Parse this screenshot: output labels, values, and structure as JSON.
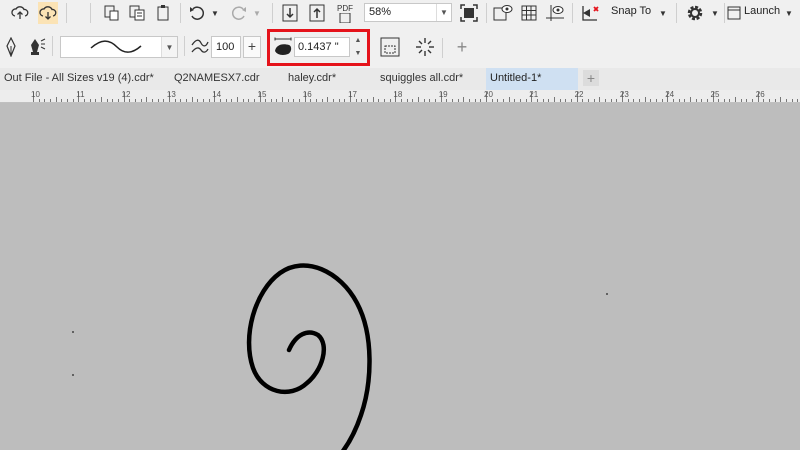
{
  "toolbar": {
    "zoom_value": "58%",
    "snap_label": "Snap To",
    "launch_label": "Launch",
    "pdf_label": "PDF"
  },
  "property_bar": {
    "smoothing_value": "100",
    "outline_width_value": "0.1437 \""
  },
  "tabs": [
    {
      "label": "Out File - All Sizes v19 (4).cdr*",
      "active": false
    },
    {
      "label": "Q2NAMESX7.cdr",
      "active": false
    },
    {
      "label": "haley.cdr*",
      "active": false
    },
    {
      "label": "squiggles all.cdr*",
      "active": false
    },
    {
      "label": "Untitled-1*",
      "active": true
    }
  ],
  "ruler": {
    "labels": [
      "10",
      "11",
      "12",
      "13",
      "14",
      "15",
      "16",
      "17",
      "18",
      "19",
      "20",
      "21",
      "22",
      "23",
      "24",
      "25",
      "26"
    ]
  },
  "colors": {
    "highlight": "#e5131b",
    "active_tab": "#cfe0f2",
    "canvas": "#bdbdbd"
  }
}
